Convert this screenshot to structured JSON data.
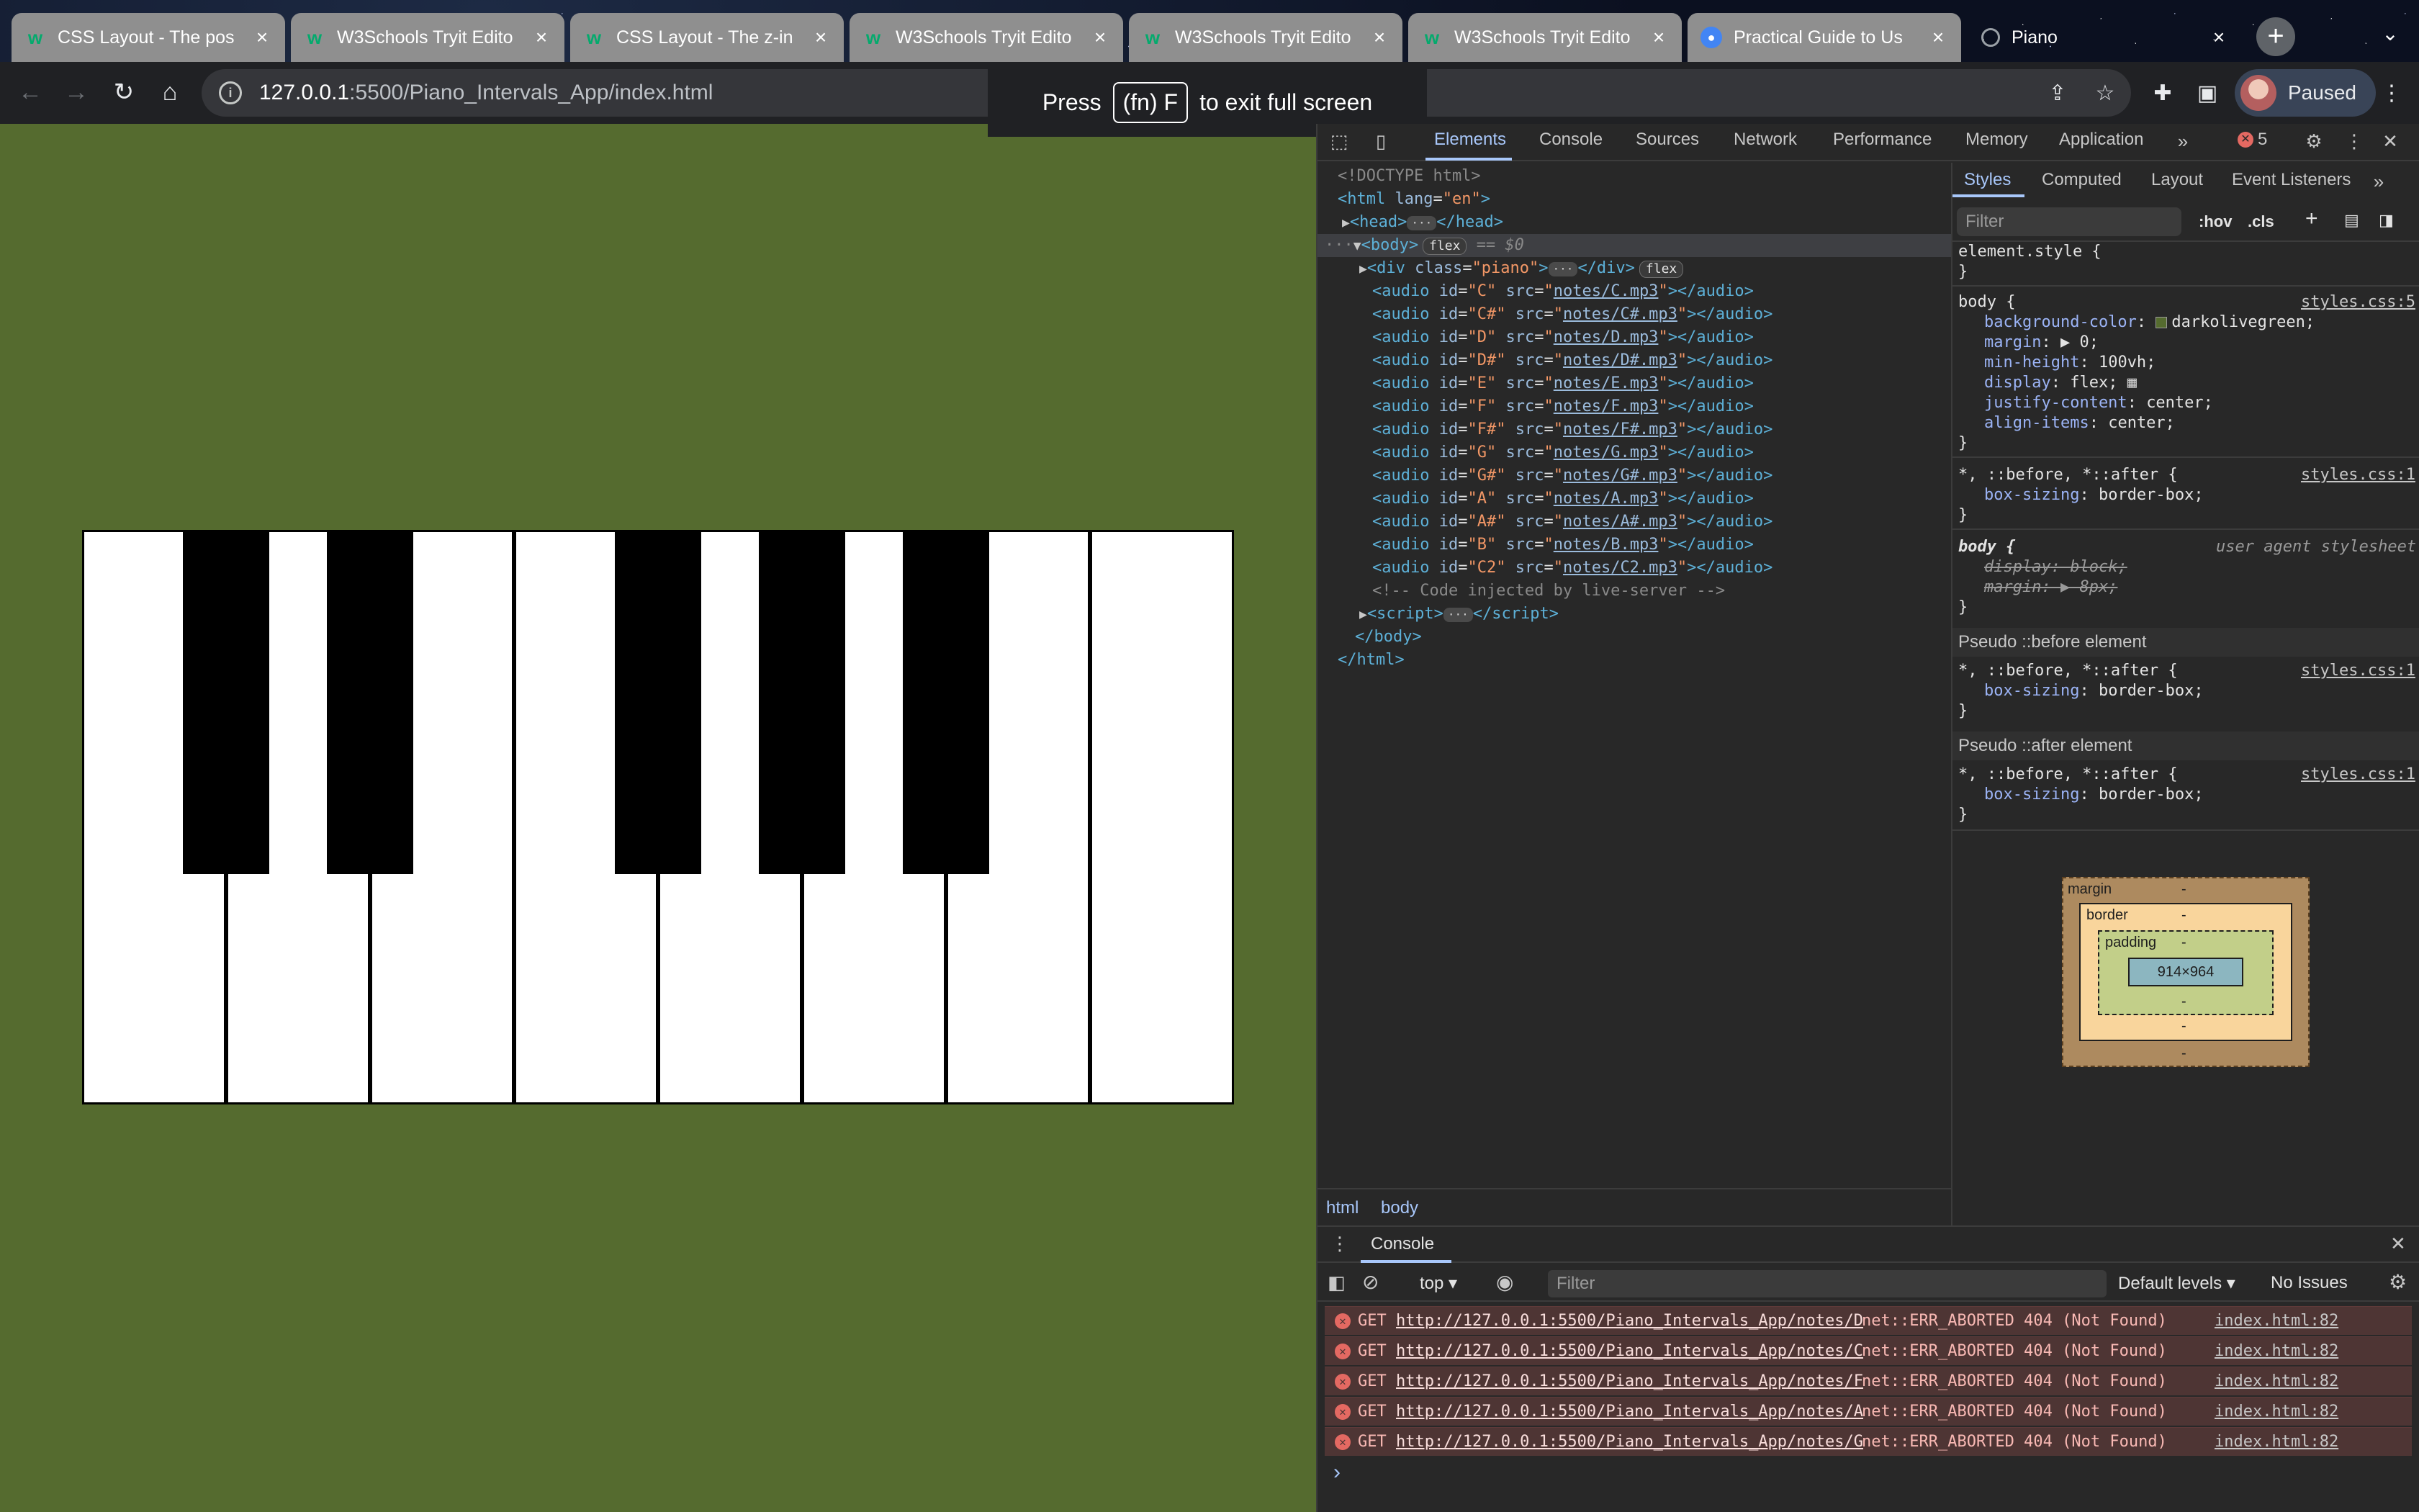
{
  "browser": {
    "tabs": [
      {
        "label": "CSS Layout - The pos",
        "icon": "w3schools-icon"
      },
      {
        "label": "W3Schools Tryit Edito",
        "icon": "w3schools-icon"
      },
      {
        "label": "CSS Layout - The z-in",
        "icon": "w3schools-icon"
      },
      {
        "label": "W3Schools Tryit Edito",
        "icon": "w3schools-icon"
      },
      {
        "label": "W3Schools Tryit Edito",
        "icon": "w3schools-icon"
      },
      {
        "label": "W3Schools Tryit Edito",
        "icon": "w3schools-icon"
      },
      {
        "label": "Practical Guide to Us",
        "icon": "chrome-icon"
      },
      {
        "label": "Piano",
        "icon": "globe-icon"
      }
    ],
    "url_host": "127.0.0.1",
    "url_rest": ":5500/Piano_Intervals_App/index.html",
    "profile_label": "Paused",
    "fullscreen_toast": {
      "before": "Press",
      "key": "(fn) F",
      "after": "to exit full screen"
    }
  },
  "page": {
    "background": "#556b2f",
    "white_keys": [
      "C",
      "D",
      "E",
      "F",
      "G",
      "A",
      "B",
      "C2"
    ],
    "black_keys": [
      "C#",
      "D#",
      "F#",
      "G#",
      "A#"
    ]
  },
  "devtools": {
    "tabs": [
      "Elements",
      "Console",
      "Sources",
      "Network",
      "Performance",
      "Memory",
      "Application"
    ],
    "error_count": "5",
    "dom": {
      "doctype": "<!DOCTYPE html>",
      "html_open_tag": "html",
      "lang_attr": "lang",
      "lang_val": "\"en\"",
      "head": "head",
      "body": "body",
      "flex_pill": "flex",
      "selected_marker": "== $0",
      "piano_div_class": "\"piano\"",
      "audio": [
        {
          "id": "\"C\"",
          "src": "notes/C.mp3"
        },
        {
          "id": "\"C#\"",
          "src": "notes/C#.mp3"
        },
        {
          "id": "\"D\"",
          "src": "notes/D.mp3"
        },
        {
          "id": "\"D#\"",
          "src": "notes/D#.mp3"
        },
        {
          "id": "\"E\"",
          "src": "notes/E.mp3"
        },
        {
          "id": "\"F\"",
          "src": "notes/F.mp3"
        },
        {
          "id": "\"F#\"",
          "src": "notes/F#.mp3"
        },
        {
          "id": "\"G\"",
          "src": "notes/G.mp3"
        },
        {
          "id": "\"G#\"",
          "src": "notes/G#.mp3"
        },
        {
          "id": "\"A\"",
          "src": "notes/A.mp3"
        },
        {
          "id": "\"A#\"",
          "src": "notes/A#.mp3"
        },
        {
          "id": "\"B\"",
          "src": "notes/B.mp3"
        },
        {
          "id": "\"C2\"",
          "src": "notes/C2.mp3"
        }
      ],
      "comment": "<!-- Code injected by live-server -->",
      "script": "script",
      "body_close": "</body>",
      "html_close": "</html>"
    },
    "breadcrumbs": [
      "html",
      "body"
    ],
    "styles": {
      "tabs": [
        "Styles",
        "Computed",
        "Layout",
        "Event Listeners"
      ],
      "filter_placeholder": "Filter",
      "hov": ":hov",
      "cls": ".cls",
      "element_style": "element.style {",
      "close_brace": "}",
      "body_rule": {
        "selector": "body {",
        "source": "styles.css:5",
        "props": [
          {
            "name": "background-color",
            "value": "darkolivegreen;"
          },
          {
            "name": "margin",
            "value": "▶ 0;"
          },
          {
            "name": "min-height",
            "value": "100vh;"
          },
          {
            "name": "display",
            "value": "flex;"
          },
          {
            "name": "justify-content",
            "value": "center;"
          },
          {
            "name": "align-items",
            "value": "center;"
          }
        ]
      },
      "universal_rule": {
        "selector": "*, ::before, *::after {",
        "source": "styles.css:1",
        "prop": "box-sizing",
        "value": "border-box;"
      },
      "ua_rule": {
        "selector": "body {",
        "source": "user agent stylesheet",
        "props": [
          {
            "name": "display",
            "value": "block;"
          },
          {
            "name": "margin",
            "value": "▶ 8px;"
          }
        ]
      },
      "pseudo_before": "Pseudo ::before element",
      "pseudo_after": "Pseudo ::after element"
    },
    "box_model": {
      "margin": "margin",
      "border": "border",
      "padding": "padding",
      "content": "914×964",
      "dash": "-"
    },
    "console": {
      "title": "Console",
      "context": "top",
      "filter_placeholder": "Filter",
      "levels": "Default levels",
      "issues": "No Issues",
      "errors": [
        {
          "method": "GET",
          "url": "http://127.0.0.1:5500/Piano_Intervals_App/notes/D",
          "status": "net::ERR_ABORTED 404 (Not Found)",
          "source": "index.html:82"
        },
        {
          "method": "GET",
          "url": "http://127.0.0.1:5500/Piano_Intervals_App/notes/C",
          "status": "net::ERR_ABORTED 404 (Not Found)",
          "source": "index.html:82"
        },
        {
          "method": "GET",
          "url": "http://127.0.0.1:5500/Piano_Intervals_App/notes/F",
          "status": "net::ERR_ABORTED 404 (Not Found)",
          "source": "index.html:82"
        },
        {
          "method": "GET",
          "url": "http://127.0.0.1:5500/Piano_Intervals_App/notes/A",
          "status": "net::ERR_ABORTED 404 (Not Found)",
          "source": "index.html:82"
        },
        {
          "method": "GET",
          "url": "http://127.0.0.1:5500/Piano_Intervals_App/notes/G",
          "status": "net::ERR_ABORTED 404 (Not Found)",
          "source": "index.html:82"
        }
      ],
      "prompt": "›"
    }
  }
}
